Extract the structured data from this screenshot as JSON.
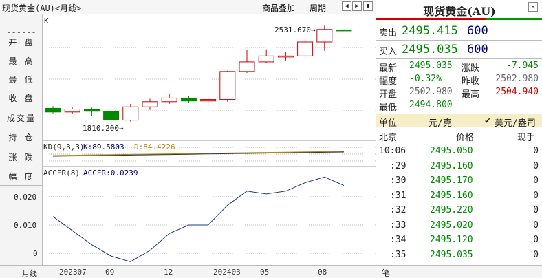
{
  "topbar": {
    "title": "现货黄金(AU)<月线>",
    "link_overlay": "商品叠加",
    "link_cycle": "周期"
  },
  "left_labels": [
    "开 盘",
    "最 高",
    "最 低",
    "收 盘",
    "成交量",
    "持 仓",
    "涨 跌",
    "幅 度"
  ],
  "left_dash": "------",
  "chart": {
    "k_label": "K",
    "high_marker": "2531.670→",
    "low_marker": "1810.200→",
    "kd_label": "KD(9,3,3)",
    "kd_k": "K:89.5803",
    "kd_d": "D:84.4226",
    "accer_label": "ACCER(8)",
    "accer_value": "ACCER:0.0239",
    "accer_ticks": [
      "0.020",
      "0.010",
      "0"
    ],
    "candles": [
      {
        "o": 1970,
        "c": 1945,
        "h": 1985,
        "l": 1935
      },
      {
        "o": 1945,
        "c": 1965,
        "h": 1975,
        "l": 1930
      },
      {
        "o": 1965,
        "c": 1950,
        "h": 1975,
        "l": 1920
      },
      {
        "o": 1950,
        "c": 1890,
        "h": 1955,
        "l": 1810
      },
      {
        "o": 1890,
        "c": 1980,
        "h": 2000,
        "l": 1880
      },
      {
        "o": 1980,
        "c": 2015,
        "h": 2035,
        "l": 1960
      },
      {
        "o": 2015,
        "c": 2040,
        "h": 2070,
        "l": 2000
      },
      {
        "o": 2040,
        "c": 2020,
        "h": 2055,
        "l": 2005
      },
      {
        "o": 2020,
        "c": 2030,
        "h": 2045,
        "l": 1995
      },
      {
        "o": 2030,
        "c": 2220,
        "h": 2225,
        "l": 2015
      },
      {
        "o": 2220,
        "c": 2285,
        "h": 2365,
        "l": 2210
      },
      {
        "o": 2285,
        "c": 2325,
        "h": 2370,
        "l": 2280
      },
      {
        "o": 2325,
        "c": 2325,
        "h": 2355,
        "l": 2290
      },
      {
        "o": 2325,
        "c": 2420,
        "h": 2440,
        "l": 2310
      },
      {
        "o": 2420,
        "c": 2505,
        "h": 2531,
        "l": 2360
      },
      {
        "o": 2502,
        "c": 2495,
        "h": 2505,
        "l": 2495
      }
    ],
    "accer_series": [
      0.013,
      0.008,
      0.003,
      -0.001,
      -0.003,
      0.001,
      0.007,
      0.01,
      0.01,
      0.017,
      0.022,
      0.021,
      0.022,
      0.025,
      0.027,
      0.024
    ],
    "x_labels": [
      "月线",
      "202307",
      "09",
      "12",
      "202403",
      "05",
      "08"
    ]
  },
  "quote": {
    "title": "现货黄金(AU)",
    "sell_label": "卖出",
    "sell_price": "2495.415",
    "sell_vol": "600",
    "buy_label": "买入",
    "buy_price": "2495.035",
    "buy_vol": "600",
    "latest_label": "最新",
    "latest": "2495.035",
    "change_label": "涨跌",
    "change": "-7.945",
    "pct_label": "幅度",
    "pct": "-0.32%",
    "prev_label": "昨收",
    "prev": "2502.980",
    "open_label": "开盘",
    "open": "2502.980",
    "high_label": "最高",
    "high": "2504.940",
    "low_label": "最低",
    "low": "2494.800",
    "unit_label": "单位",
    "unit": "元/克",
    "unit2": "美元/盎司",
    "col_time": "北京",
    "col_price": "价格",
    "col_vol": "现手",
    "ticks": [
      {
        "t": "10:06",
        "p": "2495.050",
        "v": "0"
      },
      {
        "t": ":29",
        "p": "2495.160",
        "v": "0"
      },
      {
        "t": ":30",
        "p": "2495.170",
        "v": "0"
      },
      {
        "t": ":31",
        "p": "2495.160",
        "v": "0"
      },
      {
        "t": ":32",
        "p": "2495.220",
        "v": "0"
      },
      {
        "t": ":33",
        "p": "2495.020",
        "v": "0"
      },
      {
        "t": ":34",
        "p": "2495.120",
        "v": "0"
      },
      {
        "t": ":35",
        "p": "2495.035",
        "v": "0"
      }
    ],
    "bottom_tab": "笔"
  }
}
